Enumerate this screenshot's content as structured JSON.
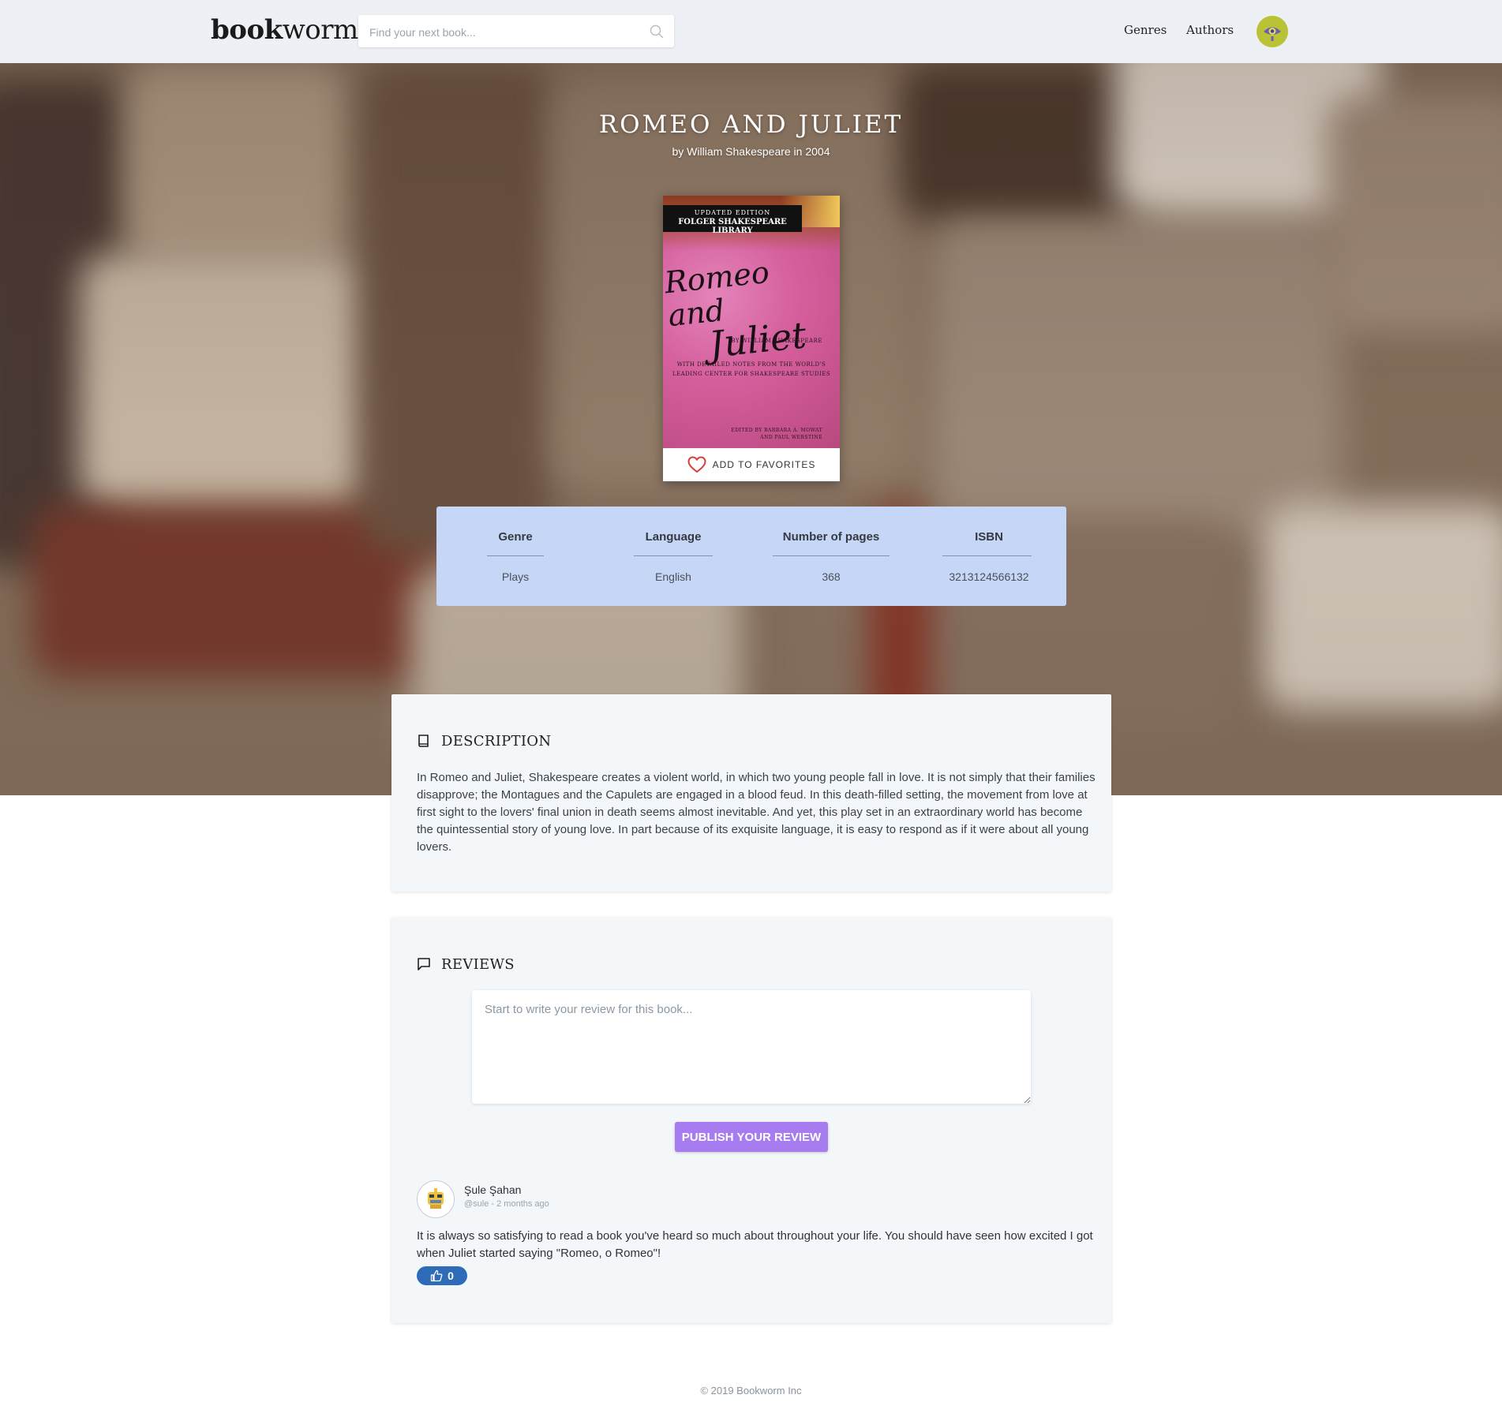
{
  "header": {
    "logo_bold": "book",
    "logo_light": "worm",
    "search_placeholder": "Find your next book...",
    "nav": [
      {
        "label": "Genres"
      },
      {
        "label": "Authors"
      }
    ],
    "avatar_icon": "eye-avatar-icon"
  },
  "book": {
    "title": "ROMEO AND JULIET",
    "subtitle": "by William Shakespeare in 2004",
    "cover": {
      "edition": "UPDATED EDITION",
      "library": "FOLGER SHAKESPEARE LIBRARY",
      "script_line1": "Romeo and",
      "script_line2": "Juliet",
      "by": "BY WILLIAM SHAKESPEARE",
      "notes1": "WITH DETAILED NOTES FROM THE WORLD'S",
      "notes2": "LEADING CENTER FOR SHAKESPEARE STUDIES",
      "editors1": "EDITED BY BARBARA A. MOWAT",
      "editors2": "AND PAUL WERSTINE"
    },
    "favorite_label": "ADD TO FAVORITES",
    "info": [
      {
        "head": "Genre",
        "value": "Plays"
      },
      {
        "head": "Language",
        "value": "English"
      },
      {
        "head": "Number of pages",
        "value": "368"
      },
      {
        "head": "ISBN",
        "value": "3213124566132"
      }
    ]
  },
  "description": {
    "title": "DESCRIPTION",
    "text": "In Romeo and Juliet, Shakespeare creates a violent world, in which two young people fall in love. It is not simply that their families disapprove; the Montagues and the Capulets are engaged in a blood feud. In this death-filled setting, the movement from love at first sight to the lovers' final union in death seems almost inevitable. And yet, this play set in an extraordinary world has become the quintessential story of young love. In part because of its exquisite language, it is easy to respond as if it were about all young lovers."
  },
  "reviews": {
    "title": "REVIEWS",
    "placeholder": "Start to write your review for this book...",
    "publish_label": "PUBLISH YOUR REVIEW",
    "items": [
      {
        "name": "Şule Şahan",
        "meta": "@sule - 2 months ago",
        "text": "It is always so satisfying to read a book you've heard so much about throughout your life. You should have seen how excited I got when Juliet started saying \"Romeo, o Romeo\"!",
        "likes": "0"
      }
    ]
  },
  "footer": {
    "text": "© 2019 Bookworm Inc"
  },
  "colors": {
    "header_bg": "#edf1f5",
    "info_bg": "#c5d6f7",
    "publish_bg": "#a67cf0",
    "like_bg": "#2e6cb8",
    "card_bg": "#f4f7fa"
  }
}
